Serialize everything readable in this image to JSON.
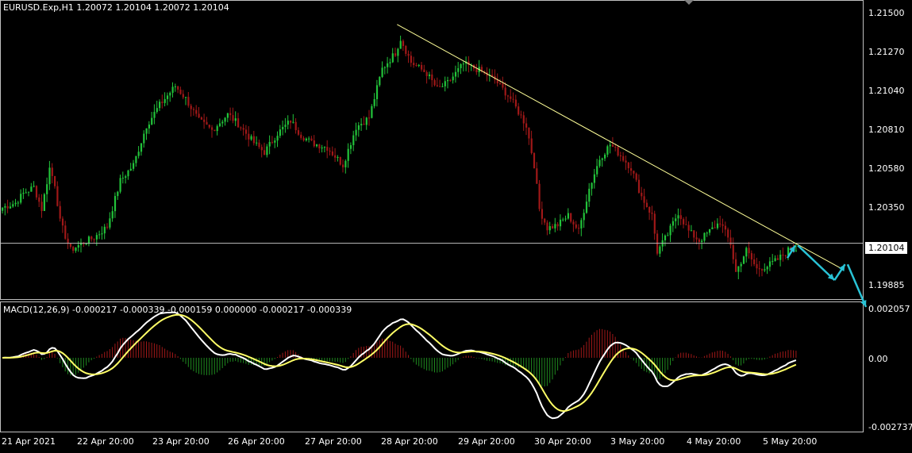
{
  "header": {
    "symbol_info": "EURUSD.Exp,H1  1.20072 1.20104 1.20072 1.20104",
    "macd_info": "MACD(12,26,9) -0.000217 -0.000339 -0.000159 0.000000 -0.000217 -0.000339"
  },
  "price_axis": {
    "ticks": [
      "1.21500",
      "1.21270",
      "1.21040",
      "1.20810",
      "1.20580",
      "1.20350",
      "1.19885"
    ],
    "tick_values": [
      1.215,
      1.2127,
      1.2104,
      1.2081,
      1.2058,
      1.2035,
      1.19885
    ],
    "current_price": "1.20104",
    "current_value": 1.20104
  },
  "macd_axis": {
    "ticks": [
      "0.002057",
      "0.00",
      "-0.002737"
    ],
    "tick_values": [
      0.002057,
      0.0,
      -0.002737
    ]
  },
  "time_axis": {
    "labels": [
      "21 Apr 2021",
      "22 Apr 20:00",
      "23 Apr 20:00",
      "26 Apr 20:00",
      "27 Apr 20:00",
      "28 Apr 20:00",
      "29 Apr 20:00",
      "30 Apr 20:00",
      "3 May 20:00",
      "4 May 20:00",
      "5 May 20:00"
    ]
  },
  "colors": {
    "bull": "#22c33a",
    "bear": "#a01818",
    "macd_main": "#ffffff",
    "macd_signal": "#ffff66",
    "hist_pos": "#a01818",
    "hist_neg": "#1f8a1f",
    "trendline": "#ffff99",
    "arrow": "#29c3d6",
    "grid_line": "#c0c0c0"
  },
  "chart_data": {
    "type": "candlestick",
    "symbol": "EURUSD.Exp",
    "timeframe": "H1",
    "ylim": [
      1.1976,
      1.2162
    ],
    "close_path_anchors": [
      [
        0,
        1.2033
      ],
      [
        5,
        1.2036
      ],
      [
        8,
        1.2042
      ],
      [
        12,
        1.2046
      ],
      [
        15,
        1.2032
      ],
      [
        18,
        1.2058
      ],
      [
        20,
        1.2048
      ],
      [
        22,
        1.2024
      ],
      [
        26,
        1.2006
      ],
      [
        30,
        1.201
      ],
      [
        35,
        1.2014
      ],
      [
        40,
        1.2021
      ],
      [
        45,
        1.205
      ],
      [
        50,
        1.206
      ],
      [
        55,
        1.2085
      ],
      [
        60,
        1.2098
      ],
      [
        66,
        1.211
      ],
      [
        70,
        1.2102
      ],
      [
        75,
        1.2088
      ],
      [
        80,
        1.2082
      ],
      [
        86,
        1.2092
      ],
      [
        90,
        1.2086
      ],
      [
        96,
        1.2074
      ],
      [
        100,
        1.2068
      ],
      [
        105,
        1.208
      ],
      [
        110,
        1.2088
      ],
      [
        114,
        1.2079
      ],
      [
        118,
        1.2074
      ],
      [
        124,
        1.2071
      ],
      [
        130,
        1.206
      ],
      [
        135,
        1.2084
      ],
      [
        140,
        1.209
      ],
      [
        145,
        1.2121
      ],
      [
        150,
        1.2131
      ],
      [
        152,
        1.214
      ],
      [
        156,
        1.2125
      ],
      [
        162,
        1.2118
      ],
      [
        166,
        1.2108
      ],
      [
        170,
        1.2112
      ],
      [
        176,
        1.2124
      ],
      [
        182,
        1.212
      ],
      [
        188,
        1.2114
      ],
      [
        194,
        1.2102
      ],
      [
        200,
        1.2085
      ],
      [
        203,
        1.206
      ],
      [
        205,
        1.2032
      ],
      [
        208,
        1.202
      ],
      [
        212,
        1.2022
      ],
      [
        216,
        1.2028
      ],
      [
        220,
        1.2018
      ],
      [
        224,
        1.2045
      ],
      [
        228,
        1.2064
      ],
      [
        232,
        1.2073
      ],
      [
        236,
        1.2066
      ],
      [
        240,
        1.2058
      ],
      [
        244,
        1.204
      ],
      [
        248,
        1.2028
      ],
      [
        250,
        1.2005
      ],
      [
        254,
        1.2016
      ],
      [
        258,
        1.203
      ],
      [
        262,
        1.2018
      ],
      [
        266,
        1.2012
      ],
      [
        270,
        1.2018
      ],
      [
        274,
        1.2024
      ],
      [
        278,
        1.201
      ],
      [
        280,
        1.1992
      ],
      [
        284,
        1.2006
      ],
      [
        288,
        1.1994
      ],
      [
        292,
        1.1996
      ],
      [
        296,
        1.2
      ],
      [
        300,
        1.2006
      ],
      [
        303,
        1.2007
      ]
    ],
    "trendline": {
      "from": [
        151,
        1.2149
      ],
      "to": [
        321,
        1.1994
      ]
    },
    "current_price_line": 1.20104,
    "forecast_arrows": [
      {
        "from": [
          300,
          1.2001
        ],
        "to": [
          303,
          1.2009
        ]
      },
      {
        "from": [
          304,
          1.2009
        ],
        "to": [
          318,
          1.1987
        ]
      },
      {
        "from": [
          318,
          1.1987
        ],
        "to": [
          322,
          1.1997
        ]
      },
      {
        "from": [
          323,
          1.1997
        ],
        "to": [
          330,
          1.197
        ]
      }
    ],
    "macd": {
      "fast": 12,
      "slow": 26,
      "signal": 9,
      "main": -0.000217,
      "signal_value": -0.000339,
      "ylim": [
        -0.00288,
        0.00215
      ]
    }
  }
}
